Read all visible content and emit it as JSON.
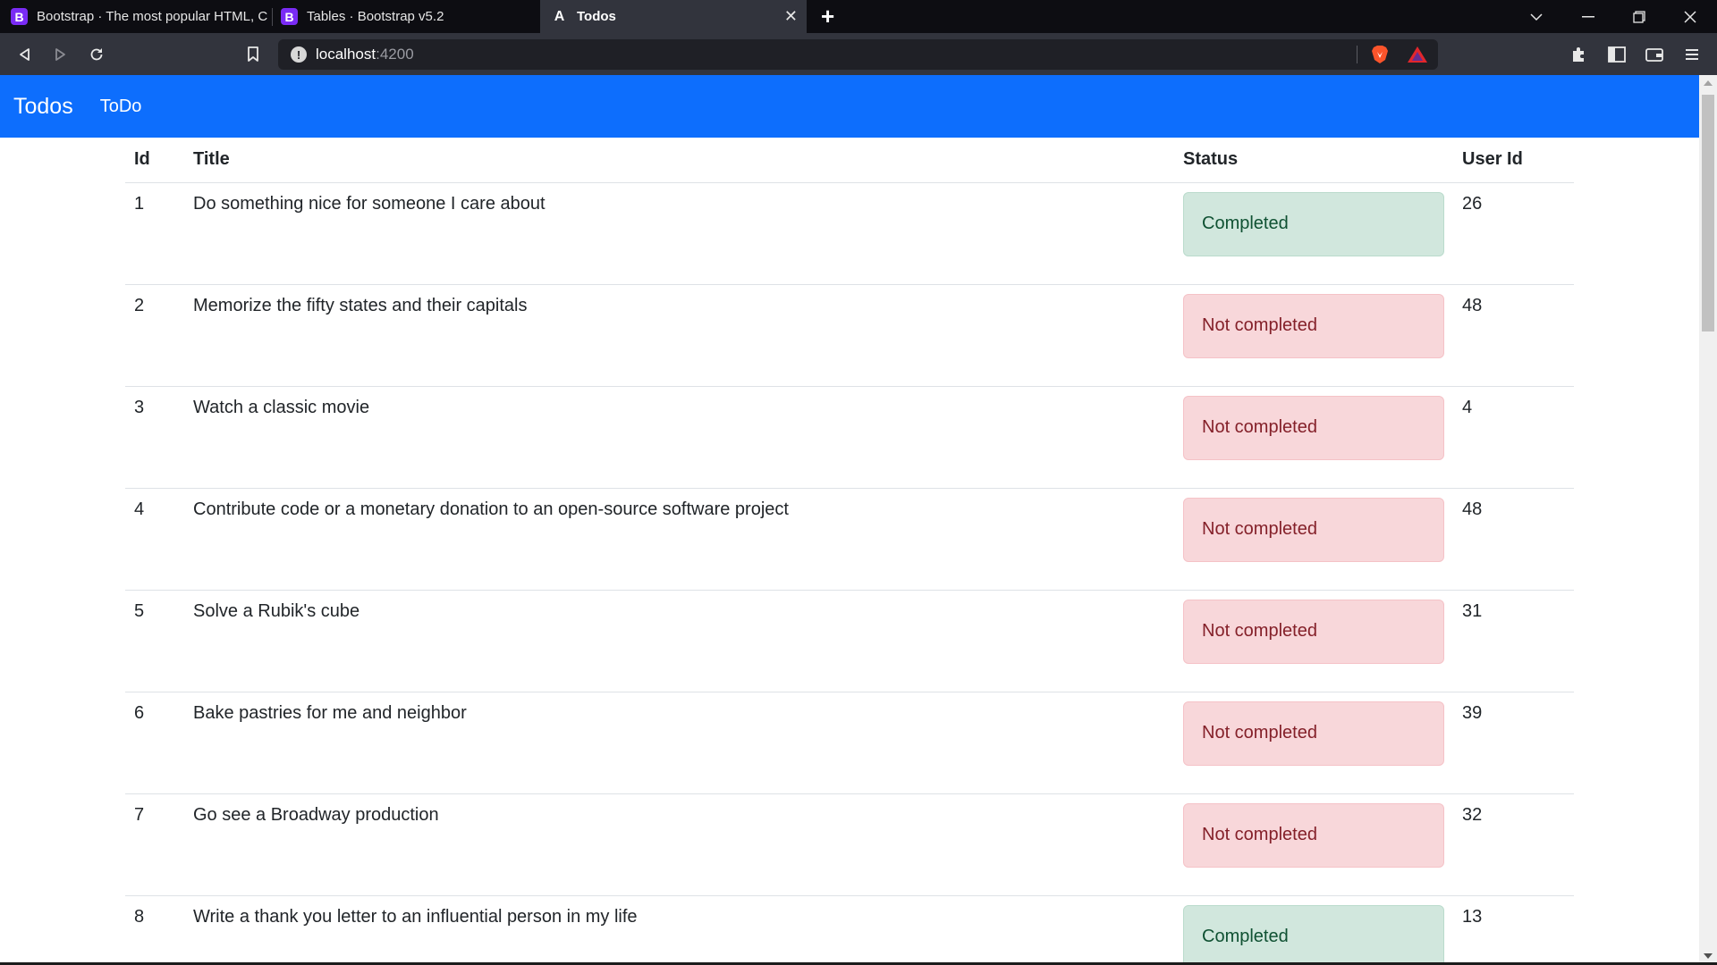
{
  "browser": {
    "tabs": [
      {
        "title": "Bootstrap · The most popular HTML, C",
        "favicon": "B",
        "active": false
      },
      {
        "title": "Tables · Bootstrap v5.2",
        "favicon": "B",
        "active": false
      },
      {
        "title": "Todos",
        "favicon": "A",
        "active": true
      }
    ],
    "tab_close_glyph": "✕",
    "new_tab_glyph": "+",
    "window_controls": {
      "tab_search": "⌄",
      "minimize": "—",
      "restore": "❐",
      "close": "✕"
    },
    "url_host": "localhost",
    "url_port": ":4200",
    "icons": [
      "back-icon",
      "forward-icon",
      "reload-icon",
      "bookmark-icon",
      "site-info-icon",
      "brave-shields-icon",
      "brave-rewards-icon",
      "extensions-icon",
      "sidebar-icon",
      "wallet-icon",
      "menu-icon"
    ]
  },
  "navbar": {
    "brand": "Todos",
    "link": "ToDo",
    "color": "#0d6efd"
  },
  "table": {
    "headers": {
      "id": "Id",
      "title": "Title",
      "status": "Status",
      "user_id": "User Id"
    },
    "rows": [
      {
        "id": "1",
        "title": "Do something nice for someone I care about",
        "status": "Completed",
        "completed": true,
        "user_id": "26"
      },
      {
        "id": "2",
        "title": "Memorize the fifty states and their capitals",
        "status": "Not completed",
        "completed": false,
        "user_id": "48"
      },
      {
        "id": "3",
        "title": "Watch a classic movie",
        "status": "Not completed",
        "completed": false,
        "user_id": "4"
      },
      {
        "id": "4",
        "title": "Contribute code or a monetary donation to an open-source software project",
        "status": "Not completed",
        "completed": false,
        "user_id": "48"
      },
      {
        "id": "5",
        "title": "Solve a Rubik's cube",
        "status": "Not completed",
        "completed": false,
        "user_id": "31"
      },
      {
        "id": "6",
        "title": "Bake pastries for me and neighbor",
        "status": "Not completed",
        "completed": false,
        "user_id": "39"
      },
      {
        "id": "7",
        "title": "Go see a Broadway production",
        "status": "Not completed",
        "completed": false,
        "user_id": "32"
      },
      {
        "id": "8",
        "title": "Write a thank you letter to an influential person in my life",
        "status": "Completed",
        "completed": true,
        "user_id": "13"
      }
    ]
  },
  "colors": {
    "completed_bg": "#d1e7dd",
    "completed_text": "#0f5132",
    "not_completed_bg": "#f8d7da",
    "not_completed_text": "#842029"
  }
}
